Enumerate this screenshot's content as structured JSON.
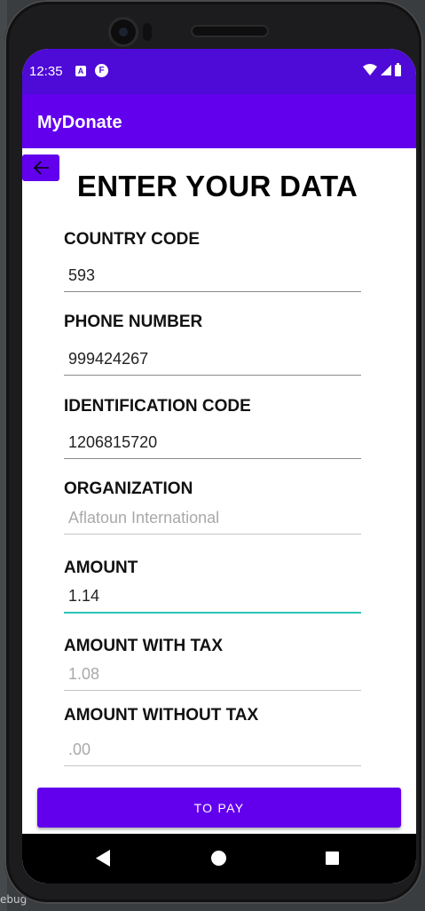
{
  "status_bar": {
    "time": "12:35",
    "icon_a": "A",
    "icon_f": "F"
  },
  "app_bar": {
    "title": "MyDonate"
  },
  "page": {
    "heading": "ENTER YOUR DATA"
  },
  "form": {
    "country_code": {
      "label": "COUNTRY CODE",
      "value": "593"
    },
    "phone_number": {
      "label": "PHONE NUMBER",
      "value": "999424267"
    },
    "identification_code": {
      "label": "IDENTIFICATION CODE",
      "value": "1206815720"
    },
    "organization": {
      "label": "ORGANIZATION",
      "value": "Aflatoun International"
    },
    "amount": {
      "label": "AMOUNT",
      "value": "1.14"
    },
    "amount_with_tax": {
      "label": "AMOUNT WITH TAX",
      "value": "1.08"
    },
    "amount_without_tax": {
      "label": "AMOUNT WITHOUT TAX",
      "value": ".00"
    }
  },
  "actions": {
    "pay_label": "TO PAY"
  },
  "ide": {
    "debug_label": "ebug"
  },
  "colors": {
    "status_bar": "#4e0ad6",
    "primary": "#6200ee",
    "focus_underline": "#2bc4b4"
  },
  "icons": [
    "back-arrow-icon",
    "wifi-icon",
    "cell-signal-icon",
    "battery-icon",
    "nav-back-icon",
    "nav-home-icon",
    "nav-recent-icon"
  ]
}
